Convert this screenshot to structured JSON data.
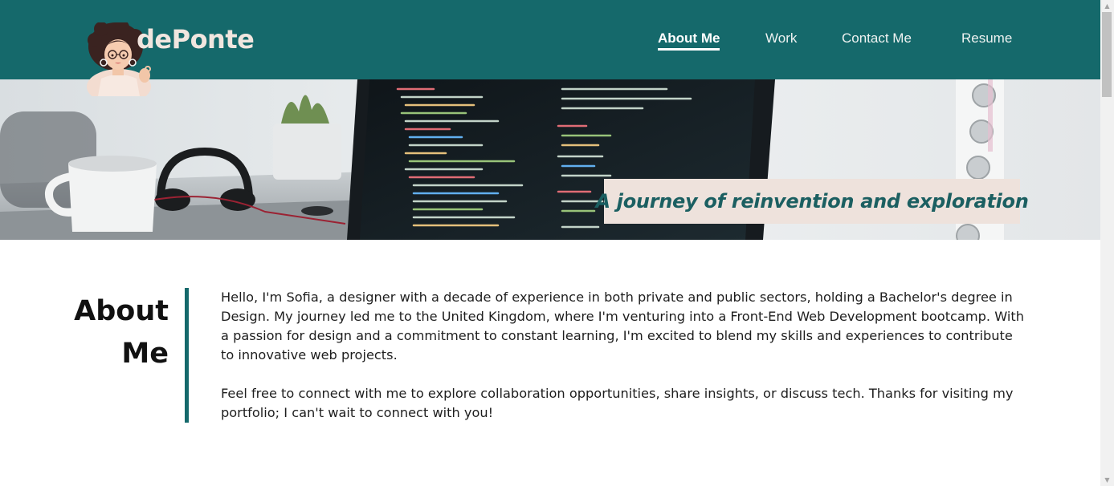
{
  "header": {
    "brand": "dePonte",
    "nav": [
      {
        "label": "About Me",
        "active": true
      },
      {
        "label": "Work",
        "active": false
      },
      {
        "label": "Contact Me",
        "active": false
      },
      {
        "label": "Resume",
        "active": false
      }
    ]
  },
  "hero": {
    "tagline": "A journey of reinvention and exploration"
  },
  "about": {
    "heading_line1": "About",
    "heading_line2": "Me",
    "paragraphs": [
      "Hello, I'm Sofia, a designer with a decade of experience in both private and public sectors, holding a Bachelor's degree in Design. My journey led me to the United Kingdom, where I'm venturing into a Front-End Web Development bootcamp. With a passion for design and a commitment to constant learning, I'm excited to blend my skills and experiences to contribute to innovative web projects.",
      "Feel free to connect with me to explore collaboration opportunities, share insights, or discuss tech. Thanks for visiting my portfolio; I can't wait to connect with you!"
    ]
  },
  "colors": {
    "header_bg": "#15696b",
    "brand_text": "#f1e6df",
    "tagline_bg": "#eee2dc",
    "tagline_text": "#1b5f61",
    "divider": "#15696b"
  },
  "icons": {
    "avatar": "avatar-illustration",
    "scroll_up": "scroll-up-arrow-icon",
    "scroll_down": "scroll-down-arrow-icon"
  }
}
